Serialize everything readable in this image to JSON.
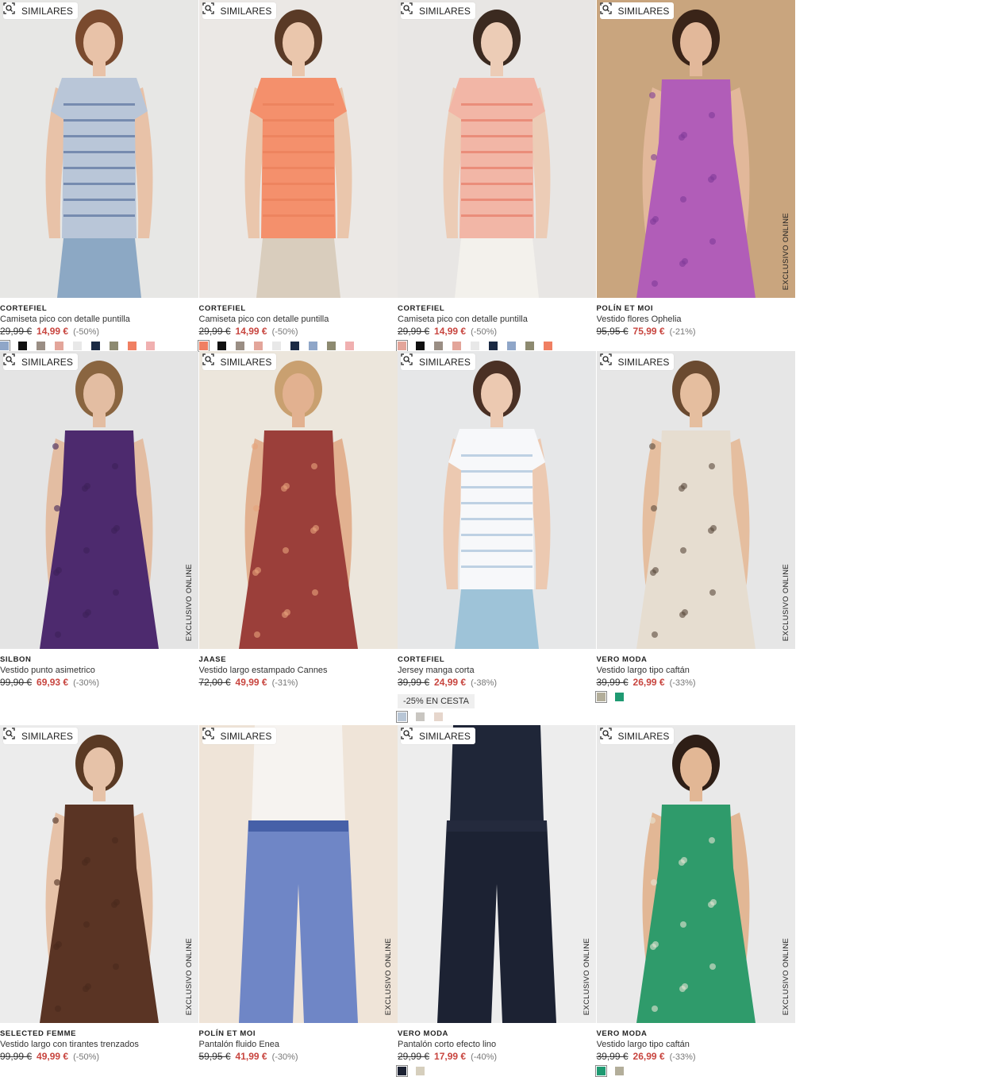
{
  "similar_label": "SIMILARES",
  "exclusive_label": "EXCLUSIVO ONLINE",
  "products": [
    {
      "brand": "CORTEFIEL",
      "name": "Camiseta pico con detalle puntilla",
      "old_price": "29,99 €",
      "price": "14,99 €",
      "discount": "(-50%)",
      "exclusive": false,
      "promo": "",
      "swatches": [
        "#8fa6c8",
        "#111111",
        "#9a8e84",
        "#e3a59a",
        "#e8e8e8",
        "#1b2a44",
        "#8d8a70",
        "#f07f62",
        "#f0b0b0"
      ],
      "bg": "#e7e7e5",
      "top": "#b9c6d8",
      "top_pattern": "#3f5b8e",
      "bottom": "#8ca8c4",
      "skin": "#e8c2a8",
      "hair": "#7a4a2e"
    },
    {
      "brand": "CORTEFIEL",
      "name": "Camiseta pico con detalle puntilla",
      "old_price": "29,99 €",
      "price": "14,99 €",
      "discount": "(-50%)",
      "exclusive": false,
      "promo": "",
      "swatches": [
        "#f07f62",
        "#111111",
        "#9a8e84",
        "#e3a59a",
        "#e8e8e8",
        "#1b2a44",
        "#8fa6c8",
        "#8d8a70",
        "#f0b0b0"
      ],
      "bg": "#ebe8e5",
      "top": "#f4906c",
      "top_pattern": "#e77a55",
      "bottom": "#d9cdbd",
      "skin": "#eac6ac",
      "hair": "#5a3a26"
    },
    {
      "brand": "CORTEFIEL",
      "name": "Camiseta pico con detalle puntilla",
      "old_price": "29,99 €",
      "price": "14,99 €",
      "discount": "(-50%)",
      "exclusive": false,
      "promo": "",
      "swatches": [
        "#e3a59a",
        "#111111",
        "#9a8e84",
        "#e3a59a",
        "#e8e8e8",
        "#1b2a44",
        "#8fa6c8",
        "#8d8a70",
        "#f07f62"
      ],
      "bg": "#e8e6e4",
      "top": "#f2b6a6",
      "top_pattern": "#e46b55",
      "bottom": "#f3f1ec",
      "skin": "#ecccb6",
      "hair": "#3b2a20"
    },
    {
      "brand": "POLÍN ET MOI",
      "name": "Vestido flores Ophelia",
      "old_price": "95,95 €",
      "price": "75,99 €",
      "discount": "(-21%)",
      "exclusive": true,
      "promo": "",
      "swatches": [],
      "bg": "#c9a57e",
      "top": "#b15db8",
      "top_pattern": "#7e3b98",
      "bottom": "#a955b3",
      "skin": "#e2b89a",
      "hair": "#3a2418"
    },
    {
      "brand": "SILBON",
      "name": "Vestido punto asimetrico",
      "old_price": "99,90 €",
      "price": "69,93 €",
      "discount": "(-30%)",
      "exclusive": true,
      "promo": "",
      "swatches": [],
      "bg": "#e4e4e4",
      "top": "#4d2a6e",
      "top_pattern": "#3e2159",
      "bottom": "#4d2a6e",
      "skin": "#e3bda2",
      "hair": "#8a6540"
    },
    {
      "brand": "JAASE",
      "name": "Vestido largo estampado Cannes",
      "old_price": "72,00 €",
      "price": "49,99 €",
      "discount": "(-31%)",
      "exclusive": false,
      "promo": "",
      "swatches": [],
      "bg": "#ece6dc",
      "top": "#9b3f3a",
      "top_pattern": "#e7a47c",
      "bottom": "#9b3f3a",
      "skin": "#e2b190",
      "hair": "#c9a070"
    },
    {
      "brand": "CORTEFIEL",
      "name": "Jersey manga corta",
      "old_price": "39,99 €",
      "price": "24,99 €",
      "discount": "(-38%)",
      "exclusive": false,
      "promo": "-25% EN CESTA",
      "swatches": [
        "#b8c6d6",
        "#c9c6c1",
        "#e6d6cc"
      ],
      "bg": "#e6e7e8",
      "top": "#f7f8fa",
      "top_pattern": "#8fb0cf",
      "bottom": "#9ec3d8",
      "skin": "#ecc9b1",
      "hair": "#4a3024"
    },
    {
      "brand": "VERO MODA",
      "name": "Vestido largo tipo caftán",
      "old_price": "39,99 €",
      "price": "26,99 €",
      "discount": "(-33%)",
      "exclusive": true,
      "promo": "",
      "swatches": [
        "#b3ae9a",
        "#1f9a72"
      ],
      "bg": "#e6e6e6",
      "top": "#e6ddd0",
      "top_pattern": "#5a4a3c",
      "bottom": "#e6ddd0",
      "skin": "#e5be9f",
      "hair": "#6a4a30"
    },
    {
      "brand": "SELECTED FEMME",
      "name": "Vestido largo con tirantes trenzados",
      "old_price": "99,99 €",
      "price": "49,99 €",
      "discount": "(-50%)",
      "exclusive": true,
      "promo": "",
      "swatches": [],
      "bg": "#ececec",
      "top": "#5a3424",
      "top_pattern": "#4a2a1c",
      "bottom": "#5a3424",
      "skin": "#e6c2a8",
      "hair": "#5a3a24"
    },
    {
      "brand": "POLÍN ET MOI",
      "name": "Pantalón fluido Enea",
      "old_price": "59,95 €",
      "price": "41,99 €",
      "discount": "(-30%)",
      "exclusive": true,
      "promo": "",
      "swatches": [],
      "bg": "#efe4d8",
      "top": "#f6f3f0",
      "top_pattern": "#1d3a8a",
      "bottom": "#6f86c6",
      "skin": "#e3b393",
      "hair": "#5a3a24"
    },
    {
      "brand": "VERO MODA",
      "name": "Pantalón corto efecto lino",
      "old_price": "29,99 €",
      "price": "17,99 €",
      "discount": "(-40%)",
      "exclusive": true,
      "promo": "",
      "swatches": [
        "#1c2233",
        "#d6cfbd"
      ],
      "bg": "#ededed",
      "top": "#1f2638",
      "top_pattern": "#2b3248",
      "bottom": "#1c2233",
      "skin": "#e0b898",
      "hair": "#3a2a20"
    },
    {
      "brand": "VERO MODA",
      "name": "Vestido largo tipo caftán",
      "old_price": "39,99 €",
      "price": "26,99 €",
      "discount": "(-33%)",
      "exclusive": true,
      "promo": "",
      "swatches": [
        "#1f9a72",
        "#b3ae9a"
      ],
      "bg": "#e9e9e9",
      "top": "#2f9b6b",
      "top_pattern": "#e8e4d4",
      "bottom": "#2f9b6b",
      "skin": "#e2b795",
      "hair": "#2e1e16"
    }
  ]
}
